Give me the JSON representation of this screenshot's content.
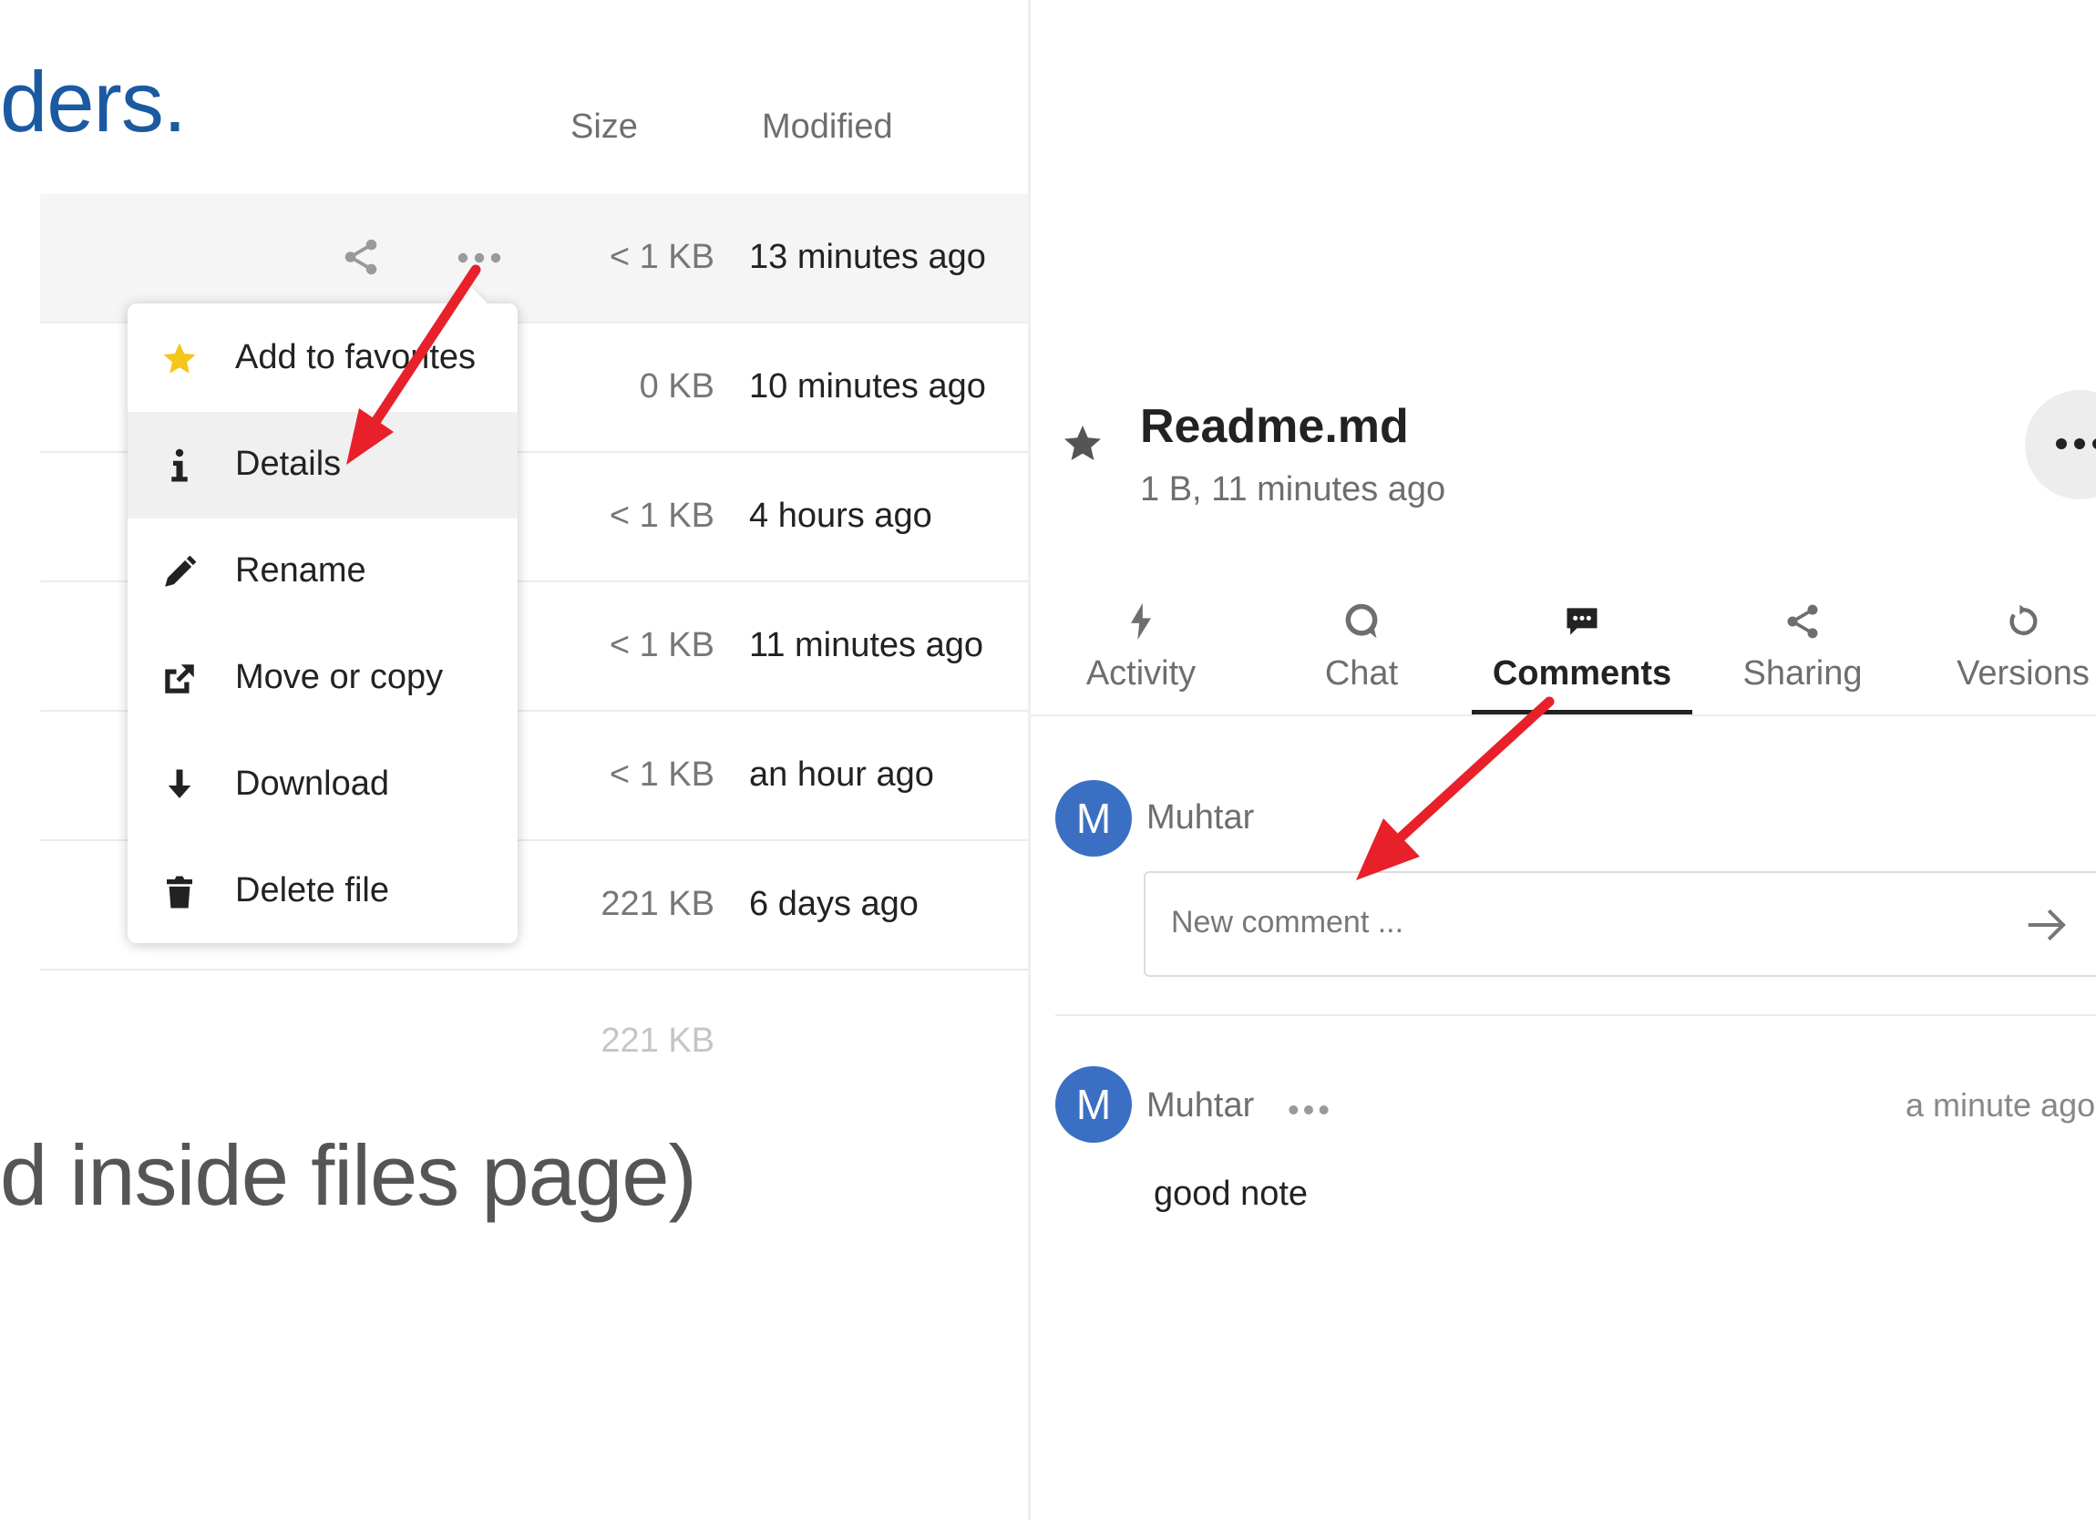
{
  "background": {
    "heading_fragment": "ders.",
    "note_fragment": "d inside files page)"
  },
  "file_list": {
    "columns": {
      "size": "Size",
      "modified": "Modified"
    },
    "rows": [
      {
        "size": "< 1 KB",
        "modified": "13 minutes ago"
      },
      {
        "size": "0 KB",
        "modified": "10 minutes ago"
      },
      {
        "size": "< 1 KB",
        "modified": "4 hours ago"
      },
      {
        "size": "< 1 KB",
        "modified": "11 minutes ago"
      },
      {
        "size": "< 1 KB",
        "modified": "an hour ago"
      },
      {
        "size": "221 KB",
        "modified": "6 days ago"
      }
    ],
    "total_size": "221 KB"
  },
  "context_menu": {
    "items": [
      {
        "label": "Add to favorites",
        "icon": "star-icon"
      },
      {
        "label": "Details",
        "icon": "info-icon"
      },
      {
        "label": "Rename",
        "icon": "pencil-icon"
      },
      {
        "label": "Move or copy",
        "icon": "external-link-icon"
      },
      {
        "label": "Download",
        "icon": "download-icon"
      },
      {
        "label": "Delete file",
        "icon": "trash-icon"
      }
    ]
  },
  "sidebar": {
    "file_name": "Readme.md",
    "file_meta": "1 B, 11 minutes ago",
    "tabs": [
      {
        "label": "Activity",
        "icon": "lightning-icon"
      },
      {
        "label": "Chat",
        "icon": "chat-icon"
      },
      {
        "label": "Comments",
        "icon": "comment-icon"
      },
      {
        "label": "Sharing",
        "icon": "share-icon"
      },
      {
        "label": "Versions",
        "icon": "history-icon"
      }
    ],
    "active_tab": "Comments",
    "new_comment": {
      "avatar_initial": "M",
      "author": "Muhtar",
      "placeholder": "New comment ...",
      "value": ""
    },
    "comments": [
      {
        "avatar_initial": "M",
        "author": "Muhtar",
        "time": "a minute ago",
        "text": "good note"
      }
    ]
  },
  "colors": {
    "link_blue": "#1b5aa0",
    "avatar_blue": "#3b6fc3",
    "favorite_star": "#f5c518",
    "annotation_red": "#e8202a"
  }
}
